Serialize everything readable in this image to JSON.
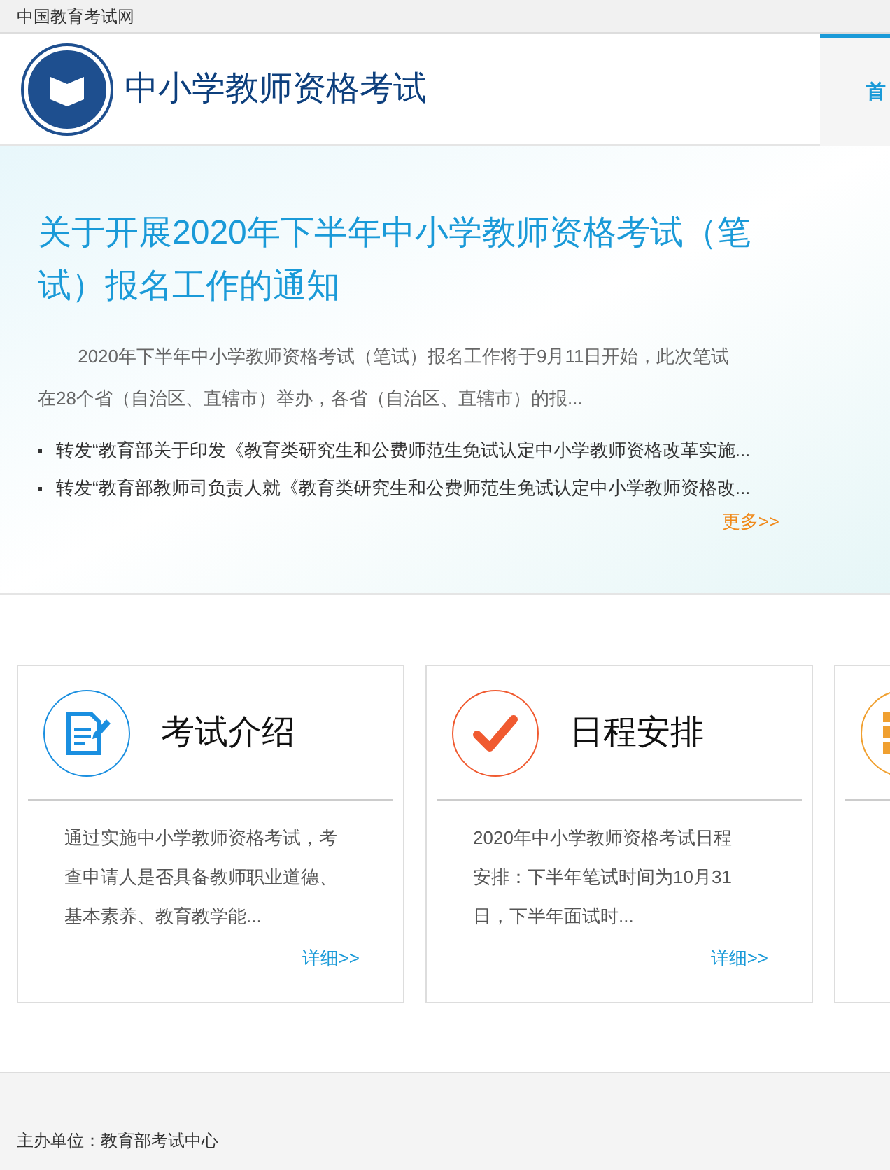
{
  "top_bar": {
    "site_name": "中国教育考试网"
  },
  "header": {
    "title": "中小学教师资格考试",
    "nav": [
      {
        "label": "首",
        "selected": true
      }
    ]
  },
  "notice": {
    "title": "关于开展2020年下半年中小学教师资格考试（笔试）报名工作的通知",
    "summary": "2020年下半年中小学教师资格考试（笔试）报名工作将于9月11日开始，此次笔试在28个省（自治区、直辖市）举办，各省（自治区、直辖市）的报...",
    "links": [
      "转发“教育部关于印发《教育类研究生和公费师范生免试认定中小学教师资格改革实施...",
      "转发“教育部教师司负责人就《教育类研究生和公费师范生免试认定中小学教师资格改..."
    ],
    "more": "更多>>"
  },
  "cards": [
    {
      "title": "考试介绍",
      "color": "#1a8fe0",
      "lines": [
        "通过实施中小学教师资格考试，考",
        "查申请人是否具备教师职业道德、",
        "基本素养、教育教学能..."
      ],
      "more": "详细>>"
    },
    {
      "title": "日程安排",
      "color": "#f05a30",
      "lines": [
        "2020年中小学教师资格考试日程",
        "安排：下半年笔试时间为10月31",
        "日，下半年面试时..."
      ],
      "more": "详细>>"
    },
    {
      "color": "#f0a030"
    }
  ],
  "footer": {
    "lines": [
      "主办单位：教育部考试中心"
    ]
  }
}
